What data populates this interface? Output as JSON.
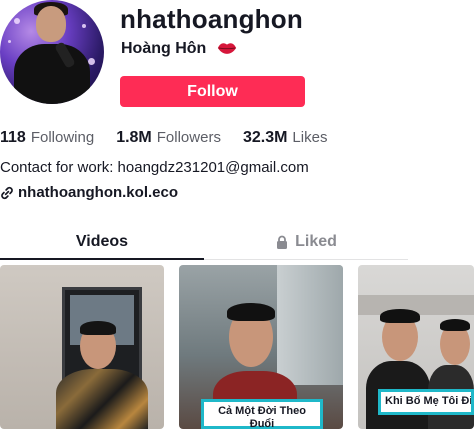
{
  "profile": {
    "username": "nhathoanghon",
    "nickname": "Hoàng Hôn",
    "nickname_icon": "lips-icon",
    "follow_label": "Follow",
    "accent_color": "#fe2c55"
  },
  "stats": [
    {
      "value": "118",
      "label": "Following"
    },
    {
      "value": "1.8M",
      "label": "Followers"
    },
    {
      "value": "32.3M",
      "label": "Likes"
    }
  ],
  "bio": {
    "contact": "Contact for work: hoangdz231201@gmail.com",
    "link_icon": "link-icon",
    "link": "nhathoanghon.kol.eco"
  },
  "tabs": {
    "videos": "Videos",
    "liked": "Liked",
    "liked_icon": "lock-icon",
    "active": "Videos"
  },
  "videos": [
    {
      "caption": ""
    },
    {
      "caption": "Cả Một Đời Theo Đuổi\nDạo Ánh"
    },
    {
      "caption": "Khi Bố Mẹ Tôi Đi V"
    }
  ]
}
